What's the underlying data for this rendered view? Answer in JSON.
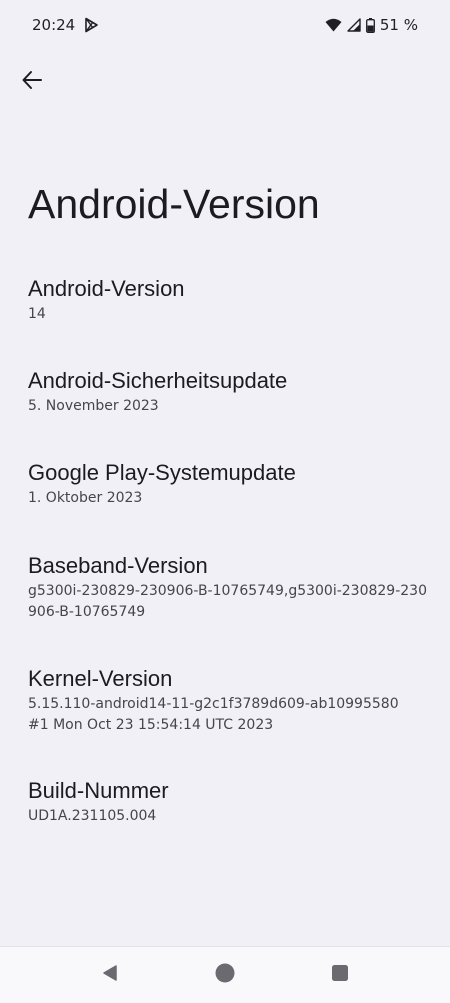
{
  "status_bar": {
    "time": "20:24",
    "battery_percent": "51 %",
    "icons": [
      "play-store-icon",
      "wifi-icon",
      "cell-signal-icon",
      "battery-icon"
    ]
  },
  "header": {
    "back_icon": "arrow-back-icon",
    "title": "Android-Version"
  },
  "items": [
    {
      "title": "Android-Version",
      "value": "14"
    },
    {
      "title": "Android-Sicherheitsupdate",
      "value": "5. November 2023"
    },
    {
      "title": "Google Play-Systemupdate",
      "value": "1. Oktober 2023"
    },
    {
      "title": "Baseband-Version",
      "value": "g5300i-230829-230906-B-10765749,g5300i-230829-230906-B-10765749"
    },
    {
      "title": "Kernel-Version",
      "value": "5.15.110-android14-11-g2c1f3789d609-ab10995580\n#1 Mon Oct 23 15:54:14 UTC 2023"
    },
    {
      "title": "Build-Nummer",
      "value": "UD1A.231105.004"
    }
  ],
  "nav_bar": {
    "buttons": [
      "back-triangle-icon",
      "home-circle-icon",
      "recents-square-icon"
    ]
  },
  "colors": {
    "background": "#f1f0f6",
    "title_text": "#1c1b20",
    "secondary_text": "#46454b",
    "nav_icon": "#6b6a70"
  }
}
